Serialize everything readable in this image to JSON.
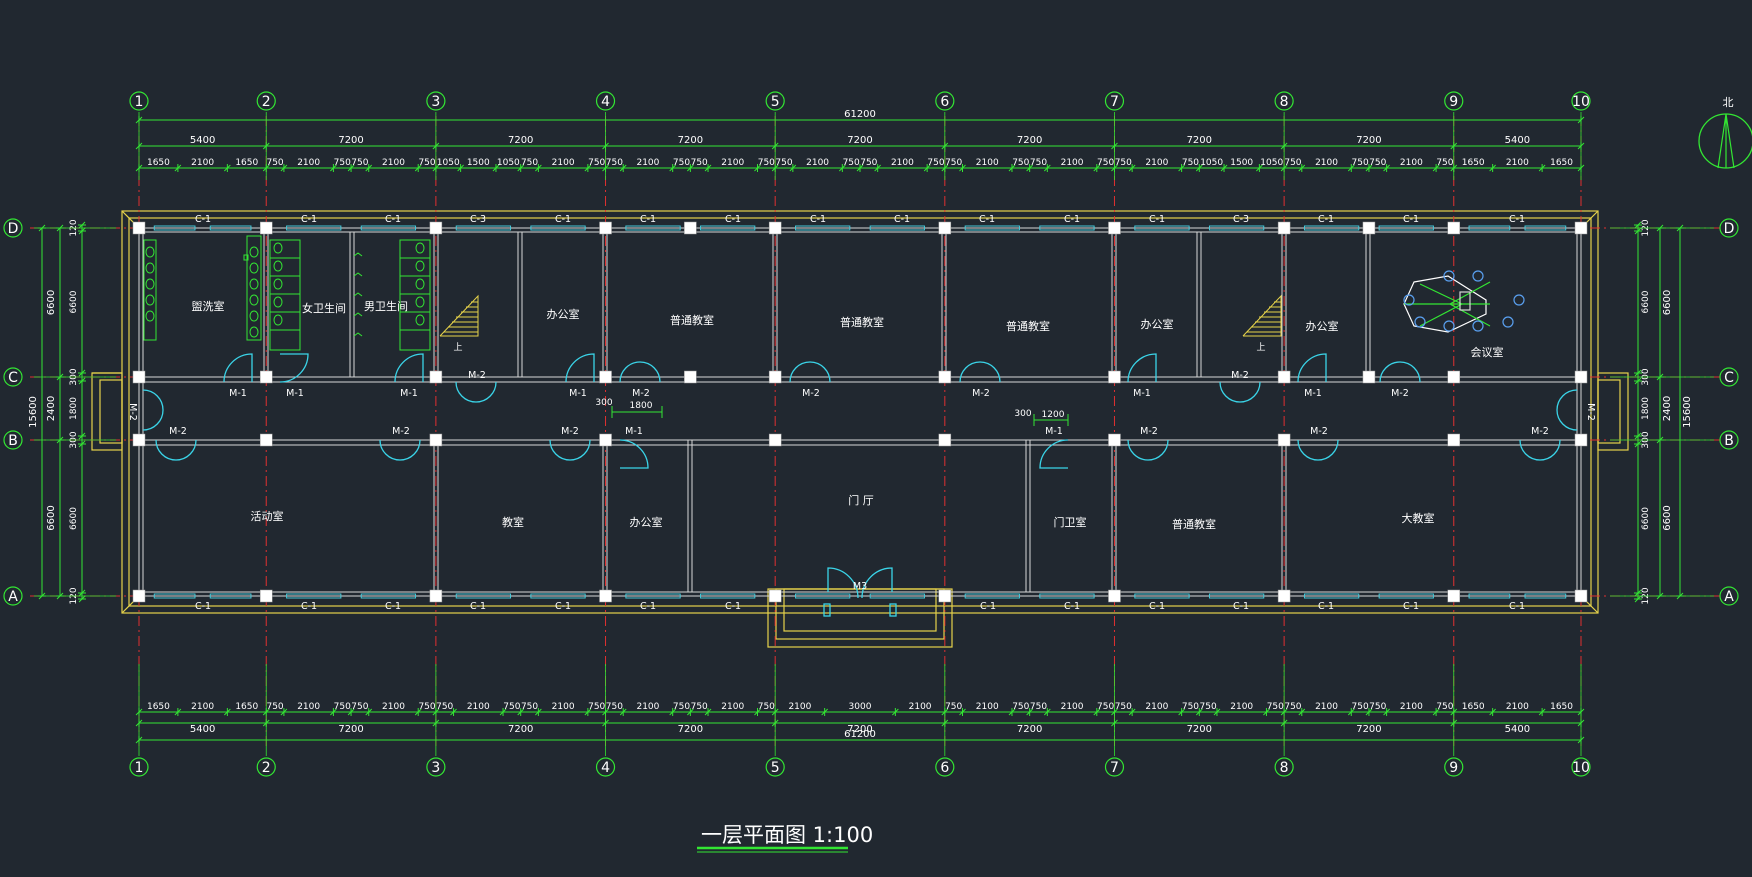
{
  "drawing_title": "一层平面图  1:100",
  "north_label": "北",
  "axes_x": [
    "1",
    "2",
    "3",
    "4",
    "5",
    "6",
    "7",
    "8",
    "9",
    "10"
  ],
  "axes_y": [
    "A",
    "B",
    "C",
    "D"
  ],
  "dims": {
    "total": "61200",
    "bays_top": [
      "5400",
      "7200",
      "7200",
      "7200",
      "7200",
      "7200",
      "7200",
      "7200",
      "5400"
    ],
    "bays_bottom": [
      "5400",
      "7200",
      "7200",
      "7200",
      "7200",
      "7200",
      "7200",
      "7200",
      "5400"
    ],
    "detail_top": [
      "1650",
      "2100",
      "1650",
      "750",
      "2100",
      "750",
      "750",
      "2100",
      "750",
      "1050",
      "1500",
      "1050",
      "750",
      "2100",
      "750",
      "750",
      "2100",
      "750",
      "750",
      "2100",
      "750",
      "750",
      "2100",
      "750",
      "750",
      "2100",
      "750",
      "750",
      "2100",
      "750",
      "750",
      "2100",
      "750",
      "750",
      "2100",
      "750",
      "1050",
      "1500",
      "1050",
      "750",
      "2100",
      "750",
      "750",
      "2100",
      "750",
      "1650",
      "2100",
      "1650"
    ],
    "detail_bottom": [
      "1650",
      "2100",
      "1650",
      "750",
      "2100",
      "750",
      "750",
      "2100",
      "750",
      "750",
      "2100",
      "750",
      "750",
      "2100",
      "750",
      "750",
      "2100",
      "750",
      "750",
      "2100",
      "750",
      "2100",
      "3000",
      "2100",
      "750",
      "2100",
      "750",
      "750",
      "2100",
      "750",
      "750",
      "2100",
      "750",
      "750",
      "2100",
      "750",
      "750",
      "2100",
      "750",
      "750",
      "2100",
      "750",
      "1650",
      "2100",
      "1650"
    ],
    "left_outer": "15600",
    "left_mid": [
      "6600",
      "2400",
      "6600"
    ],
    "left_inner": [
      "120",
      "6600",
      "300",
      "1800",
      "300",
      "6600",
      "120"
    ],
    "right_outer": "15600",
    "right_mid": [
      "6600",
      "2400",
      "6600"
    ],
    "right_inner": [
      "120",
      "6600",
      "300",
      "1800",
      "300",
      "6600",
      "120"
    ],
    "corridor_300_a": "300",
    "corridor_1800": "1800",
    "corridor_300_b": "300",
    "corridor_1200": "1200"
  },
  "rooms": {
    "r1": "盥洗室",
    "r2": "女卫生间",
    "r3": "男卫生间",
    "r4": "办公室",
    "r5": "普通教室",
    "r6": "普通教室",
    "r7": "普通教室",
    "r8": "办公室",
    "r9": "办公室",
    "r10": "会议室",
    "r11": "活动室",
    "r12": "教室",
    "r13": "办公室",
    "r14": "门  厅",
    "r15": "门卫室",
    "r16": "普通教室",
    "r17": "大教室"
  },
  "stair_up": "上",
  "windows_top": [
    "C-1",
    "C-1",
    "C-1",
    "C-3",
    "C-1",
    "C-1",
    "C-1",
    "C-1",
    "C-1",
    "C-1",
    "C-1",
    "C-1",
    "C-3",
    "C-1",
    "C-1",
    "C-1"
  ],
  "windows_bottom": [
    "C-1",
    "C-1",
    "C-1",
    "C-1",
    "C-1",
    "C-1",
    "C-1",
    "C-1",
    "C-1",
    "C-1",
    "C-1",
    "C-1",
    "C-1",
    "C-1"
  ],
  "doors": {
    "d_c1": "M-1",
    "d_c2": "M-1",
    "d_c3": "M-1",
    "d_c4": "M-2",
    "d_c5": "M-1",
    "d_c6": "M-2",
    "d_c7": "M-2",
    "d_c8": "M-2",
    "d_c9": "M-1",
    "d_c10": "M-2",
    "d_c11": "M-1",
    "d_c12": "M-2",
    "d_b1": "M-2",
    "d_b2": "M-2",
    "d_b3": "M-2",
    "d_b4": "M-1",
    "d_b5": "M-1",
    "d_b6": "M-2",
    "d_b7": "M-2",
    "d_b8": "M-2",
    "d_end_l": "M-2",
    "d_end_r": "M-2",
    "main": "M3"
  },
  "colors": {
    "background": "#212830",
    "dimension": "#33e633",
    "axis_line": "#e03030",
    "wall": "#d8d8d8",
    "outline": "#e6d34a",
    "window": "#45c8d8",
    "door": "#3ad4e8",
    "column": "#ffffff",
    "text": "#ffffff"
  }
}
